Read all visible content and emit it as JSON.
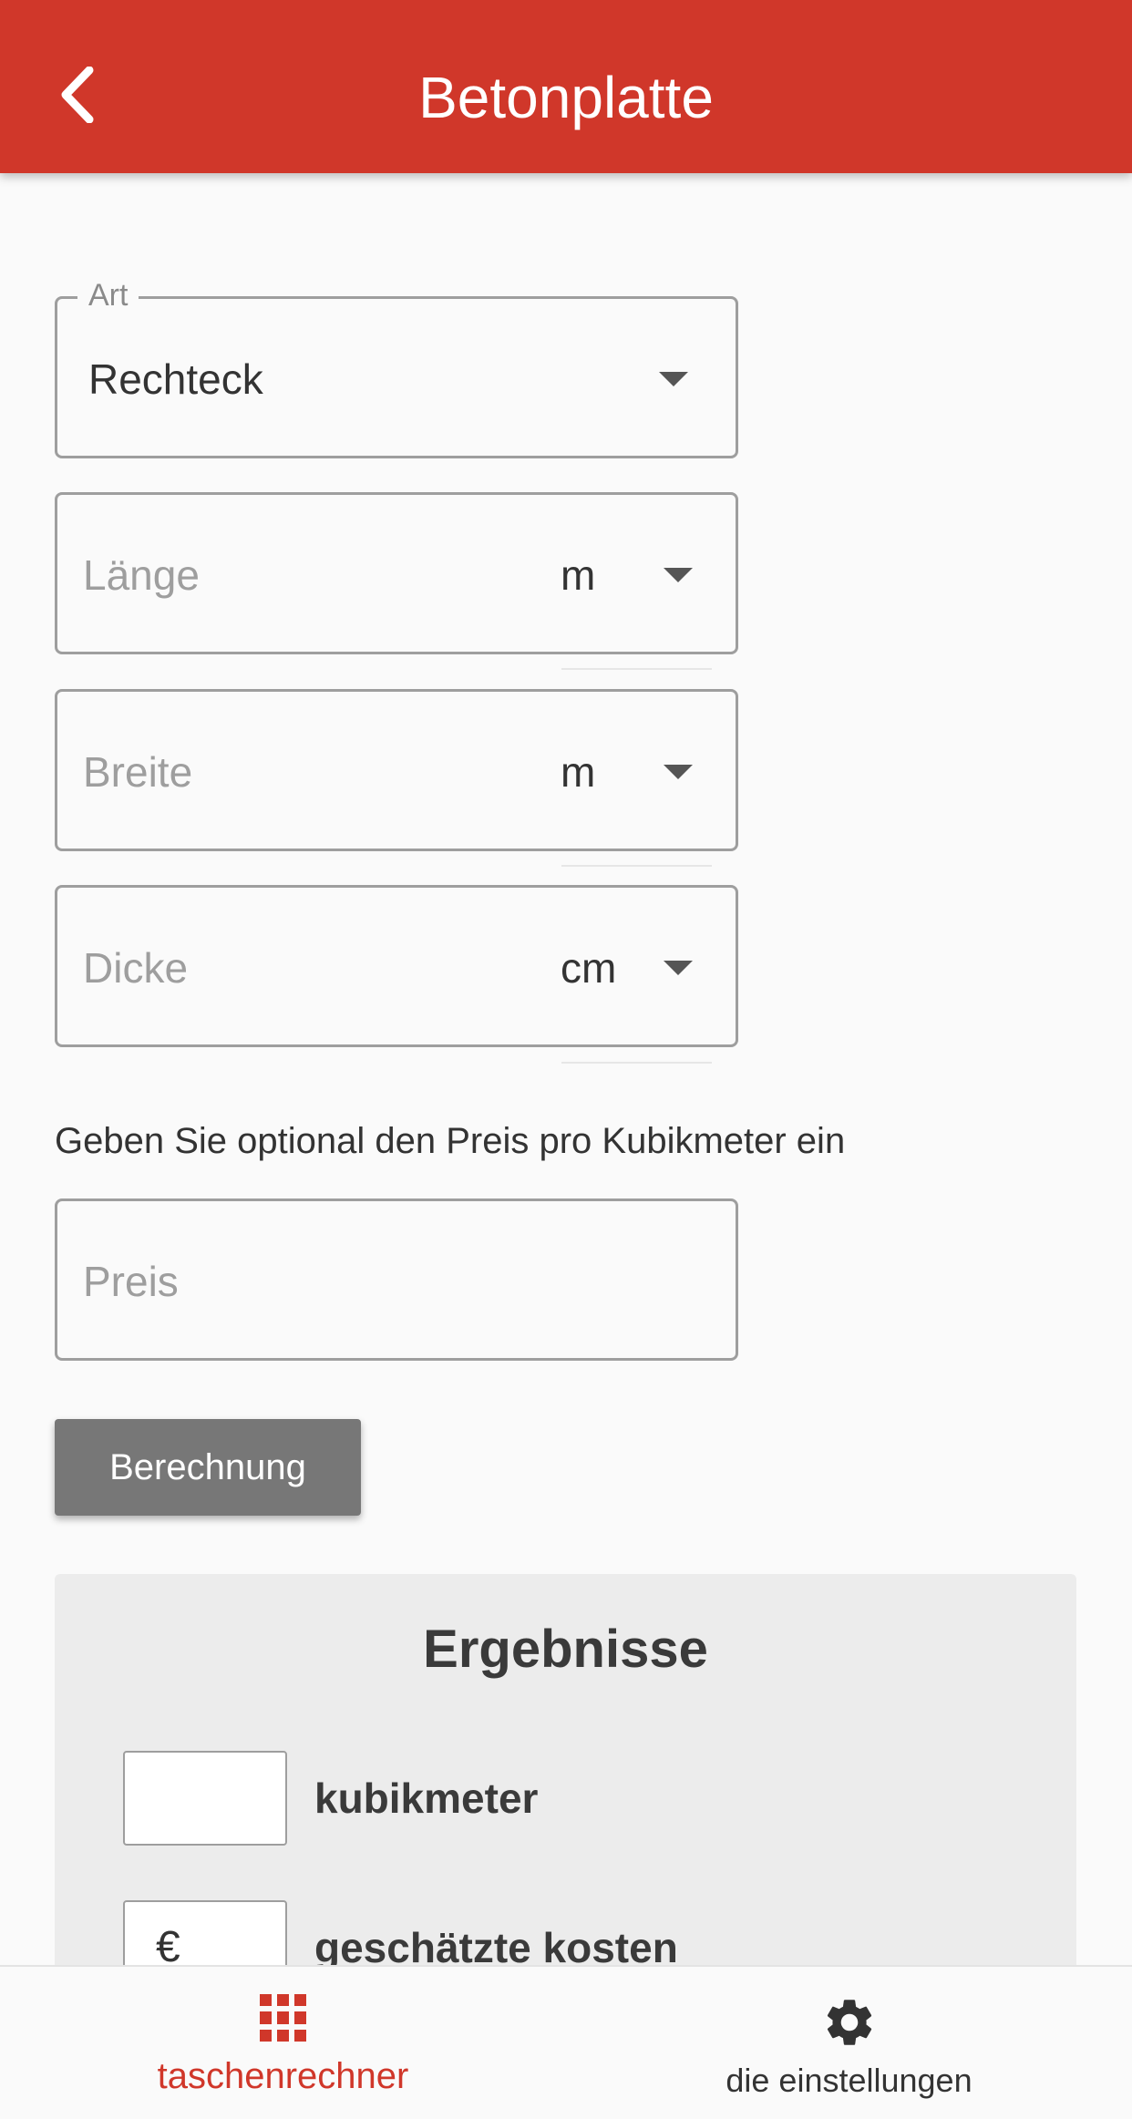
{
  "appbar": {
    "title": "Betonplatte",
    "back_icon": "chevron-left-icon",
    "color": "#d0372a"
  },
  "form": {
    "type": {
      "legend": "Art",
      "value": "Rechteck"
    },
    "length": {
      "placeholder": "Länge",
      "unit": "m"
    },
    "width": {
      "placeholder": "Breite",
      "unit": "m"
    },
    "thickness": {
      "placeholder": "Dicke",
      "unit": "cm"
    },
    "price_hint": "Geben Sie optional den Preis pro Kubikmeter ein",
    "price": {
      "placeholder": "Preis"
    },
    "calculate_label": "Berechnung"
  },
  "results": {
    "title": "Ergebnisse",
    "volume": {
      "value": "",
      "label": "kubikmeter"
    },
    "cost": {
      "currency": "€",
      "label": "geschätzte kosten"
    }
  },
  "bottom_nav": {
    "items": [
      {
        "label": "taschenrechner",
        "icon": "calculator-grid-icon",
        "active": true
      },
      {
        "label": "die einstellungen",
        "icon": "gear-icon",
        "active": false
      }
    ],
    "active_color": "#d0372a",
    "inactive_color": "#333333"
  }
}
